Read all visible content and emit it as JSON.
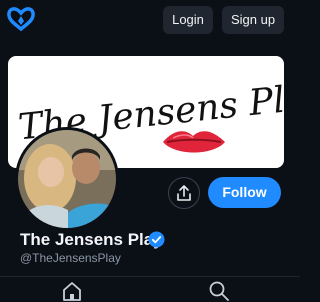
{
  "topbar": {
    "logo_icon": "butterfly-logo-icon",
    "login_label": "Login",
    "signup_label": "Sign up"
  },
  "banner": {
    "text": "The Jensens Play",
    "image": "lips-kiss-graphic"
  },
  "profile": {
    "avatar": "couple-photo-avatar",
    "display_name": "The Jensens Play",
    "verified_icon": "verified-check-icon",
    "handle": "@TheJensensPlay",
    "share_icon": "share-icon",
    "follow_label": "Follow"
  },
  "bottom_nav": {
    "items": [
      {
        "icon": "home-icon"
      },
      {
        "icon": "search-icon"
      }
    ]
  },
  "colors": {
    "background": "#0b0f16",
    "accent": "#208bfe",
    "button_dark": "#1f2630",
    "muted_text": "#8b97a5"
  }
}
